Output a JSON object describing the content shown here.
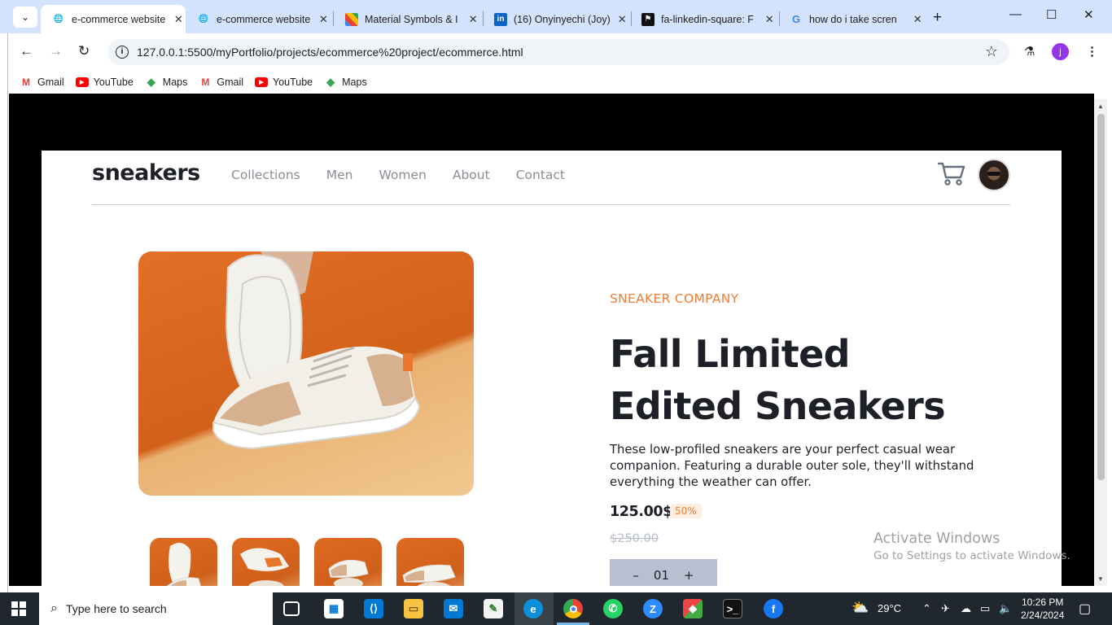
{
  "browser": {
    "tabs": [
      {
        "label": "e-commerce website",
        "active": true,
        "icon": "globe-icon"
      },
      {
        "label": "e-commerce website",
        "active": false,
        "icon": "globe-icon"
      },
      {
        "label": "Material Symbols & I",
        "active": false,
        "icon": "material-icon"
      },
      {
        "label": "(16) Onyinyechi (Joy)",
        "active": false,
        "icon": "linkedin-icon"
      },
      {
        "label": "fa-linkedin-square: F",
        "active": false,
        "icon": "flag-icon"
      },
      {
        "label": "how do i take scren",
        "active": false,
        "icon": "google-icon"
      }
    ],
    "url": "127.0.0.1:5500/myPortfolio/projects/ecommerce%20project/ecommerce.html",
    "profile_initial": "j",
    "bookmarks": [
      {
        "label": "Gmail",
        "icon": "gmail-icon"
      },
      {
        "label": "YouTube",
        "icon": "youtube-icon"
      },
      {
        "label": "Maps",
        "icon": "maps-icon"
      },
      {
        "label": "Gmail",
        "icon": "gmail-icon"
      },
      {
        "label": "YouTube",
        "icon": "youtube-icon"
      },
      {
        "label": "Maps",
        "icon": "maps-icon"
      }
    ]
  },
  "site": {
    "logo": "sneakers",
    "nav": [
      "Collections",
      "Men",
      "Women",
      "About",
      "Contact"
    ],
    "product": {
      "brand": "SNEAKER COMPANY",
      "title": "Fall Limited Edited Sneakers",
      "description": "These low-profiled sneakers are your perfect casual wear companion. Featuring a durable outer sole, they'll withstand everything the weather can offer.",
      "price": "125.00$",
      "discount": "50%",
      "old_price": "$250.00",
      "quantity": "01",
      "minus": "–",
      "plus": "+"
    },
    "colors": {
      "accent": "#ee7d32",
      "dark": "#1d2026",
      "muted": "#8a8e96"
    }
  },
  "watermark": {
    "line1": "Activate Windows",
    "line2": "Go to Settings to activate Windows."
  },
  "taskbar": {
    "search_placeholder": "Type here to search",
    "weather": "29°C",
    "time": "10:26 PM",
    "date": "2/24/2024"
  }
}
